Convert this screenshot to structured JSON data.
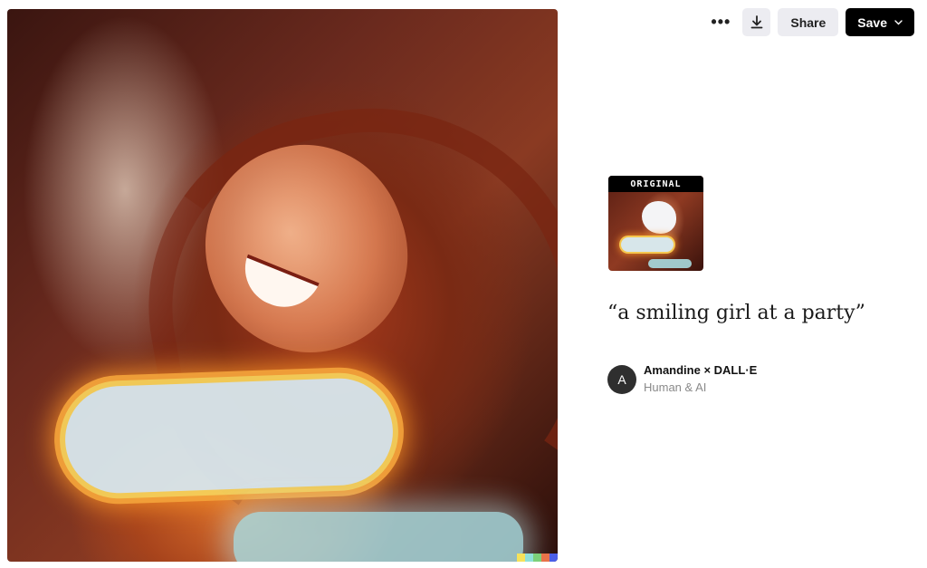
{
  "toolbar": {
    "more_icon": "more-horizontal-icon",
    "more_glyph": "•••",
    "download_icon": "download-icon",
    "share_label": "Share",
    "save_label": "Save",
    "save_chevron_icon": "chevron-down-icon"
  },
  "image": {
    "color_strip": [
      "#f6e25a",
      "#8fe0d9",
      "#7cd07a",
      "#e8734a",
      "#4b5fe8"
    ]
  },
  "original": {
    "label": "ORIGINAL"
  },
  "prompt": "“a smiling girl at a party”",
  "author": {
    "avatar_initial": "A",
    "name": "Amandine × DALL·E",
    "role": "Human & AI"
  }
}
